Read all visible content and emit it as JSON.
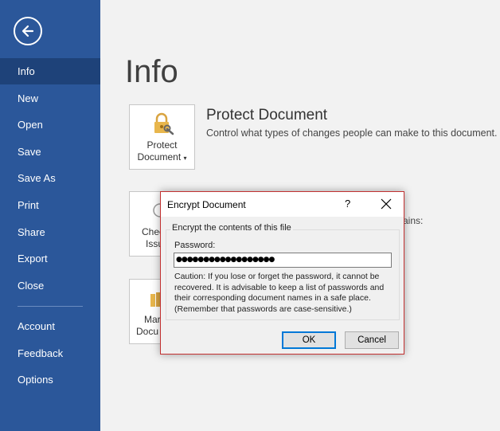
{
  "sidebar": {
    "items": [
      {
        "label": "Info"
      },
      {
        "label": "New"
      },
      {
        "label": "Open"
      },
      {
        "label": "Save"
      },
      {
        "label": "Save As"
      },
      {
        "label": "Print"
      },
      {
        "label": "Share"
      },
      {
        "label": "Export"
      },
      {
        "label": "Close"
      },
      {
        "label": "Account"
      },
      {
        "label": "Feedback"
      },
      {
        "label": "Options"
      }
    ]
  },
  "main": {
    "title": "Info",
    "protect": {
      "tile_line1": "Protect",
      "tile_line2": "Document",
      "title": "Protect Document",
      "description": "Control what types of changes people can make to this document."
    },
    "check": {
      "tile_line1": "Chec",
      "tile_line2": "Issu",
      "partial_text": "ains:"
    },
    "manage": {
      "tile_line1": "Mar",
      "tile_line2": "Docu"
    }
  },
  "dialog": {
    "title": "Encrypt Document",
    "help": "?",
    "group_label": "Encrypt the contents of this file",
    "password_label": "Password:",
    "password_value": "●●●●●●●●●●●●●●●●●●",
    "caution": "Caution: If you lose or forget the password, it cannot be recovered. It is advisable to keep a list of passwords and their corresponding document names in a safe place. (Remember that passwords are case-sensitive.)",
    "ok_label": "OK",
    "cancel_label": "Cancel"
  },
  "colors": {
    "sidebar": "#2b579a",
    "sidebar_active": "#1e4279",
    "dialog_border": "#c23030",
    "ok_focus": "#0078d7"
  }
}
